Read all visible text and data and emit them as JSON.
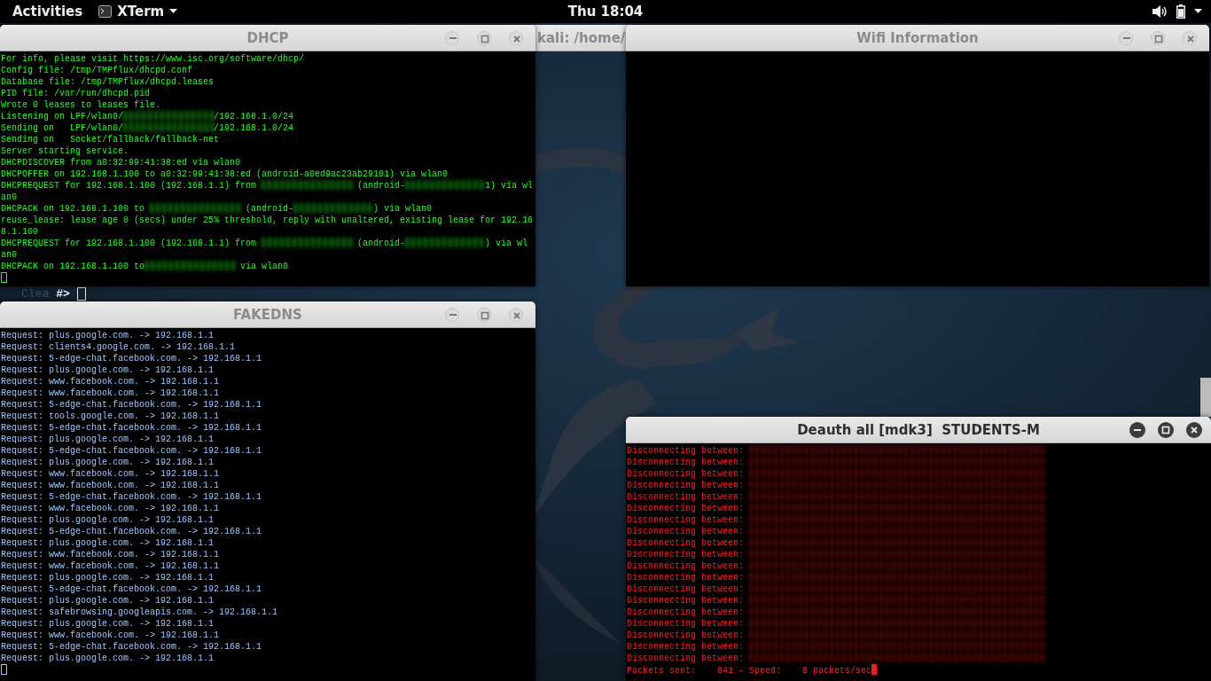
{
  "top_bar": {
    "activities": "Activities",
    "app_menu": "XTerm",
    "clock": "Thu 18:04"
  },
  "background_window": {
    "title": "kali: /home/",
    "faded_text": "Clea",
    "prompt": "#>"
  },
  "windows": [
    {
      "title": "DHCP",
      "focused": false,
      "color": "#1eff1e",
      "block_cursor": false,
      "lines": [
        [
          {
            "kind": "text",
            "text": "For info, please visit https://www.isc.org/software/dhcp/"
          }
        ],
        [
          {
            "kind": "text",
            "text": "Config file: /tmp/TMPflux/dhcpd.conf"
          }
        ],
        [
          {
            "kind": "text",
            "text": "Database file: /tmp/TMPflux/dhcpd.leases"
          }
        ],
        [
          {
            "kind": "text",
            "text": "PID file: /var/run/dhcpd.pid"
          }
        ],
        [
          {
            "kind": "text",
            "text": "Wrote 0 leases to leases file."
          }
        ],
        [
          {
            "kind": "text",
            "text": "Listening on LPF/wlan0/"
          },
          {
            "kind": "redacted-mac"
          },
          {
            "kind": "text",
            "text": "/192.168.1.0/24"
          }
        ],
        [
          {
            "kind": "text",
            "text": "Sending on   LPF/wlan0/"
          },
          {
            "kind": "redacted-mac"
          },
          {
            "kind": "text",
            "text": "/192.168.1.0/24"
          }
        ],
        [
          {
            "kind": "text",
            "text": "Sending on   Socket/fallback/fallback-net"
          }
        ],
        [
          {
            "kind": "text",
            "text": "Server starting service."
          }
        ],
        [
          {
            "kind": "text",
            "text": "DHCPDISCOVER from a0:32:99:41:38:ed via wlan0"
          }
        ],
        [
          {
            "kind": "text",
            "text": "DHCPOFFER on 192.168.1.100 to a0:32:99:41:38:ed (android-a0ed9ac23ab29101) via wlan0"
          }
        ],
        [
          {
            "kind": "text",
            "text": "DHCPREQUEST for 192.168.1.100 (192.168.1.1) from "
          },
          {
            "kind": "redacted-mac"
          },
          {
            "kind": "text",
            "text": " (android-"
          },
          {
            "kind": "redacted-id"
          },
          {
            "kind": "text",
            "text": "1) via wl"
          }
        ],
        [
          {
            "kind": "text",
            "text": "an0"
          }
        ],
        [
          {
            "kind": "text",
            "text": "DHCPACK on 192.168.1.100 to "
          },
          {
            "kind": "redacted-mac"
          },
          {
            "kind": "text",
            "text": " (android-"
          },
          {
            "kind": "redacted-id"
          },
          {
            "kind": "text",
            "text": ") via wlan0"
          }
        ],
        [
          {
            "kind": "text",
            "text": "reuse_lease: lease age 0 (secs) under 25% threshold, reply with unaltered, existing lease for 192.16"
          }
        ],
        [
          {
            "kind": "text",
            "text": "8.1.100"
          }
        ],
        [
          {
            "kind": "text",
            "text": "DHCPREQUEST for 192.168.1.100 (192.168.1.1) from "
          },
          {
            "kind": "redacted-mac"
          },
          {
            "kind": "text",
            "text": " (android-"
          },
          {
            "kind": "redacted-id"
          },
          {
            "kind": "text",
            "text": ") via wl"
          }
        ],
        [
          {
            "kind": "text",
            "text": "an0"
          }
        ],
        [
          {
            "kind": "text",
            "text": "DHCPACK on 192.168.1.100 to"
          },
          {
            "kind": "redacted-mac"
          },
          {
            "kind": "text",
            "text": " via wlan0"
          }
        ]
      ]
    },
    {
      "title": "Wifi Information",
      "focused": false
    },
    {
      "title": "FAKEDNS",
      "focused": false,
      "color": "#9cc8ff",
      "block_cursor": false,
      "lines": [
        [
          {
            "kind": "text",
            "text": "Request: plus.google.com. -> 192.168.1.1"
          }
        ],
        [
          {
            "kind": "text",
            "text": "Request: clients4.google.com. -> 192.168.1.1"
          }
        ],
        [
          {
            "kind": "text",
            "text": "Request: 5-edge-chat.facebook.com. -> 192.168.1.1"
          }
        ],
        [
          {
            "kind": "text",
            "text": "Request: plus.google.com. -> 192.168.1.1"
          }
        ],
        [
          {
            "kind": "text",
            "text": "Request: www.facebook.com. -> 192.168.1.1"
          }
        ],
        [
          {
            "kind": "text",
            "text": "Request: www.facebook.com. -> 192.168.1.1"
          }
        ],
        [
          {
            "kind": "text",
            "text": "Request: 5-edge-chat.facebook.com. -> 192.168.1.1"
          }
        ],
        [
          {
            "kind": "text",
            "text": "Request: tools.google.com. -> 192.168.1.1"
          }
        ],
        [
          {
            "kind": "text",
            "text": "Request: 5-edge-chat.facebook.com. -> 192.168.1.1"
          }
        ],
        [
          {
            "kind": "text",
            "text": "Request: plus.google.com. -> 192.168.1.1"
          }
        ],
        [
          {
            "kind": "text",
            "text": "Request: 5-edge-chat.facebook.com. -> 192.168.1.1"
          }
        ],
        [
          {
            "kind": "text",
            "text": "Request: plus.google.com. -> 192.168.1.1"
          }
        ],
        [
          {
            "kind": "text",
            "text": "Request: www.facebook.com. -> 192.168.1.1"
          }
        ],
        [
          {
            "kind": "text",
            "text": "Request: www.facebook.com. -> 192.168.1.1"
          }
        ],
        [
          {
            "kind": "text",
            "text": "Request: 5-edge-chat.facebook.com. -> 192.168.1.1"
          }
        ],
        [
          {
            "kind": "text",
            "text": "Request: www.facebook.com. -> 192.168.1.1"
          }
        ],
        [
          {
            "kind": "text",
            "text": "Request: plus.google.com. -> 192.168.1.1"
          }
        ],
        [
          {
            "kind": "text",
            "text": "Request: 5-edge-chat.facebook.com. -> 192.168.1.1"
          }
        ],
        [
          {
            "kind": "text",
            "text": "Request: plus.google.com. -> 192.168.1.1"
          }
        ],
        [
          {
            "kind": "text",
            "text": "Request: www.facebook.com. -> 192.168.1.1"
          }
        ],
        [
          {
            "kind": "text",
            "text": "Request: www.facebook.com. -> 192.168.1.1"
          }
        ],
        [
          {
            "kind": "text",
            "text": "Request: plus.google.com. -> 192.168.1.1"
          }
        ],
        [
          {
            "kind": "text",
            "text": "Request: 5-edge-chat.facebook.com. -> 192.168.1.1"
          }
        ],
        [
          {
            "kind": "text",
            "text": "Request: plus.google.com. -> 192.168.1.1"
          }
        ],
        [
          {
            "kind": "text",
            "text": "Request: safebrowsing.googleapis.com. -> 192.168.1.1"
          }
        ],
        [
          {
            "kind": "text",
            "text": "Request: plus.google.com. -> 192.168.1.1"
          }
        ],
        [
          {
            "kind": "text",
            "text": "Request: www.facebook.com. -> 192.168.1.1"
          }
        ],
        [
          {
            "kind": "text",
            "text": "Request: 5-edge-chat.facebook.com. -> 192.168.1.1"
          }
        ],
        [
          {
            "kind": "text",
            "text": "Request: plus.google.com. -> 192.168.1.1"
          }
        ]
      ]
    },
    {
      "title": "Deauth all [mdk3]  STUDENTS-M",
      "focused": true,
      "color": "#ff1a1a",
      "block_cursor": true,
      "lines": [
        [
          {
            "kind": "text",
            "text": "Disconnecting between: "
          },
          {
            "kind": "redacted-pair"
          }
        ],
        [
          {
            "kind": "text",
            "text": "Disconnecting between: "
          },
          {
            "kind": "redacted-pair"
          }
        ],
        [
          {
            "kind": "text",
            "text": "Disconnecting between: "
          },
          {
            "kind": "redacted-pair"
          }
        ],
        [
          {
            "kind": "text",
            "text": "Disconnecting between: "
          },
          {
            "kind": "redacted-pair"
          }
        ],
        [
          {
            "kind": "text",
            "text": "Disconnecting between: "
          },
          {
            "kind": "redacted-pair"
          }
        ],
        [
          {
            "kind": "text",
            "text": "Disconnecting between: "
          },
          {
            "kind": "redacted-pair"
          }
        ],
        [
          {
            "kind": "text",
            "text": "Disconnecting between: "
          },
          {
            "kind": "redacted-pair"
          }
        ],
        [
          {
            "kind": "text",
            "text": "Disconnecting between: "
          },
          {
            "kind": "redacted-pair"
          }
        ],
        [
          {
            "kind": "text",
            "text": "Disconnecting between: "
          },
          {
            "kind": "redacted-pair"
          }
        ],
        [
          {
            "kind": "text",
            "text": "Disconnecting between: "
          },
          {
            "kind": "redacted-pair"
          }
        ],
        [
          {
            "kind": "text",
            "text": "Disconnecting between: "
          },
          {
            "kind": "redacted-pair"
          }
        ],
        [
          {
            "kind": "text",
            "text": "Disconnecting between: "
          },
          {
            "kind": "redacted-pair"
          }
        ],
        [
          {
            "kind": "text",
            "text": "Disconnecting between: "
          },
          {
            "kind": "redacted-pair"
          }
        ],
        [
          {
            "kind": "text",
            "text": "Disconnecting between: "
          },
          {
            "kind": "redacted-pair"
          }
        ],
        [
          {
            "kind": "text",
            "text": "Disconnecting between: "
          },
          {
            "kind": "redacted-pair"
          }
        ],
        [
          {
            "kind": "text",
            "text": "Disconnecting between: "
          },
          {
            "kind": "redacted-pair"
          }
        ],
        [
          {
            "kind": "text",
            "text": "Disconnecting between: "
          },
          {
            "kind": "redacted-pair"
          }
        ],
        [
          {
            "kind": "text",
            "text": "Disconnecting between: "
          },
          {
            "kind": "redacted-pair"
          }
        ],
        [
          {
            "kind": "text",
            "text": "Disconnecting between: "
          },
          {
            "kind": "redacted-pair"
          }
        ],
        [
          {
            "kind": "text",
            "text": "Packets sent:    841 - Speed:    8 packets/sec"
          }
        ]
      ]
    }
  ]
}
